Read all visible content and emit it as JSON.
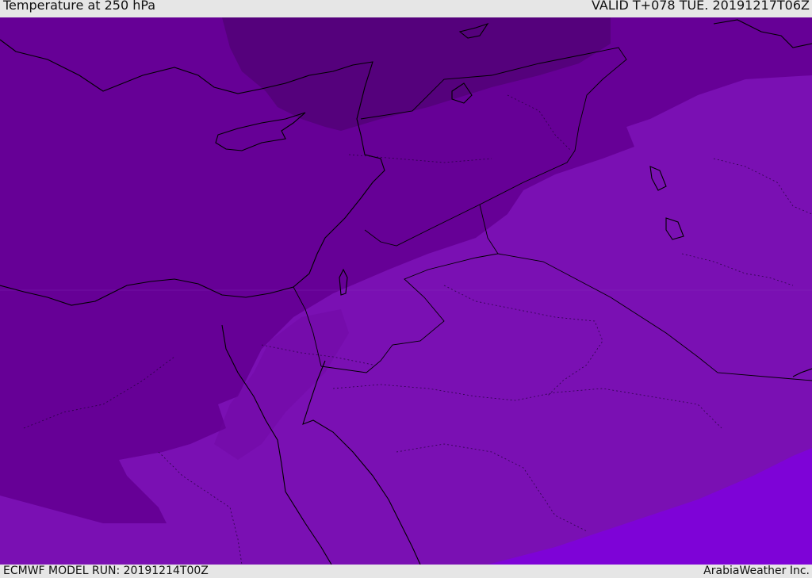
{
  "header": {
    "title": "Temperature at 250 hPa",
    "valid": "VALID T+078 TUE. 20191217T06Z"
  },
  "footer": {
    "model_run": "ECMWF MODEL RUN: 20191214T00Z",
    "credit": "ArabiaWeather Inc."
  },
  "colors": {
    "coldest": "#55017c",
    "cold": "#660096",
    "mid": "#6c059f",
    "warm": "#7a10b3",
    "warmest": "#7e03d7",
    "coastline": "#000000",
    "border": "#000000"
  }
}
